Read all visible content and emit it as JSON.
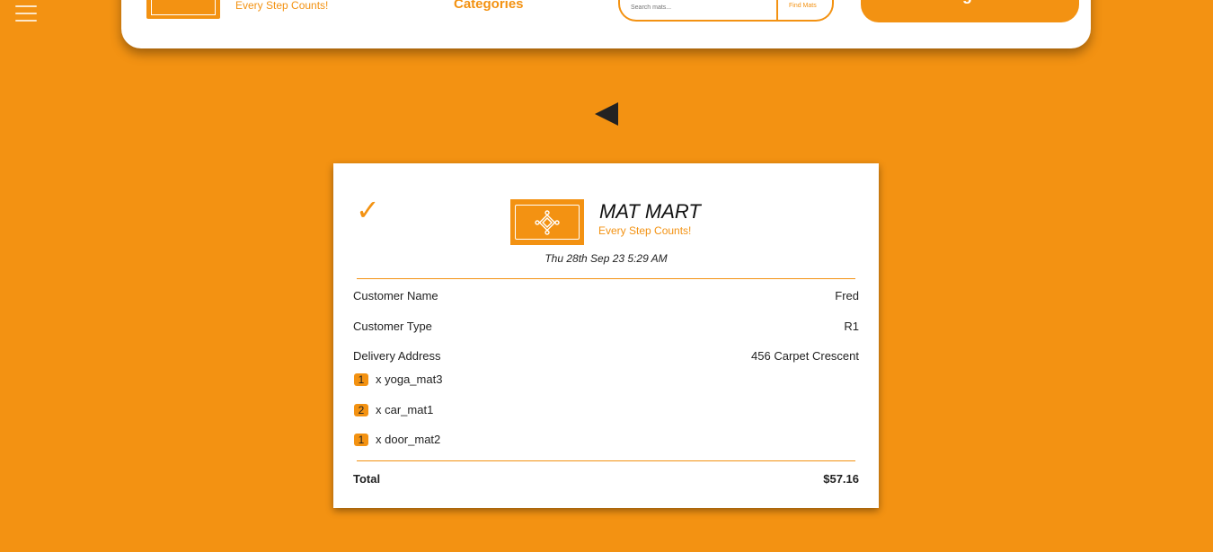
{
  "header": {
    "tagline": "Every Step Counts!",
    "categories_label": "Categories",
    "search_placeholder": "Search mats...",
    "search_button_label": "Find Mats",
    "logout_label": "Logout"
  },
  "receipt": {
    "brand": "MAT MART",
    "tagline": "Every Step Counts!",
    "date": "Thu 28th Sep 23 5:29 AM",
    "fields": [
      {
        "label": "Customer Name",
        "value": "Fred"
      },
      {
        "label": "Customer Type",
        "value": "R1"
      },
      {
        "label": "Delivery Address",
        "value": "456 Carpet Crescent"
      }
    ],
    "items": [
      {
        "qty": "1",
        "name": "x yoga_mat3"
      },
      {
        "qty": "2",
        "name": "x car_mat1"
      },
      {
        "qty": "1",
        "name": "x door_mat2"
      }
    ],
    "total_label": "Total",
    "total_value": "$57.16"
  },
  "colors": {
    "accent": "#f39212",
    "text": "#222222",
    "card": "#ffffff"
  },
  "icons": {
    "menu": "hamburger-icon",
    "back": "back-arrow-icon",
    "success": "checkmark-icon",
    "logo": "mat-logo-icon"
  }
}
